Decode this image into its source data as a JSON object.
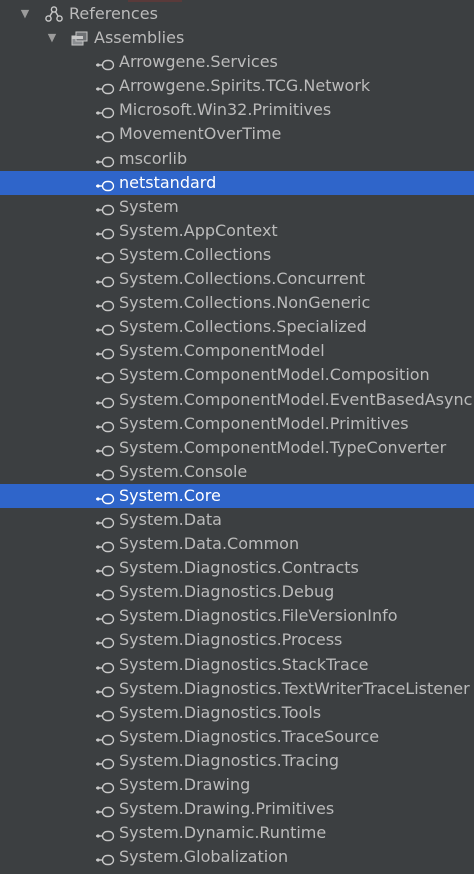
{
  "tree": {
    "references_label": "References",
    "assemblies_label": "Assemblies",
    "colors": {
      "background": "#3c3f41",
      "selection": "#2f65ca",
      "text": "#bbbbbb",
      "selected_text": "#ffffff"
    },
    "items": [
      {
        "label": "Arrowgene.Services"
      },
      {
        "label": "Arrowgene.Spirits.TCG.Network"
      },
      {
        "label": "Microsoft.Win32.Primitives"
      },
      {
        "label": "MovementOverTime"
      },
      {
        "label": "mscorlib"
      },
      {
        "label": "netstandard",
        "selected": true
      },
      {
        "label": "System"
      },
      {
        "label": "System.AppContext"
      },
      {
        "label": "System.Collections"
      },
      {
        "label": "System.Collections.Concurrent"
      },
      {
        "label": "System.Collections.NonGeneric"
      },
      {
        "label": "System.Collections.Specialized"
      },
      {
        "label": "System.ComponentModel"
      },
      {
        "label": "System.ComponentModel.Composition"
      },
      {
        "label": "System.ComponentModel.EventBasedAsync"
      },
      {
        "label": "System.ComponentModel.Primitives"
      },
      {
        "label": "System.ComponentModel.TypeConverter"
      },
      {
        "label": "System.Console"
      },
      {
        "label": "System.Core",
        "selected": true
      },
      {
        "label": "System.Data"
      },
      {
        "label": "System.Data.Common"
      },
      {
        "label": "System.Diagnostics.Contracts"
      },
      {
        "label": "System.Diagnostics.Debug"
      },
      {
        "label": "System.Diagnostics.FileVersionInfo"
      },
      {
        "label": "System.Diagnostics.Process"
      },
      {
        "label": "System.Diagnostics.StackTrace"
      },
      {
        "label": "System.Diagnostics.TextWriterTraceListener"
      },
      {
        "label": "System.Diagnostics.Tools"
      },
      {
        "label": "System.Diagnostics.TraceSource"
      },
      {
        "label": "System.Diagnostics.Tracing"
      },
      {
        "label": "System.Drawing"
      },
      {
        "label": "System.Drawing.Primitives"
      },
      {
        "label": "System.Dynamic.Runtime"
      },
      {
        "label": "System.Globalization"
      }
    ]
  }
}
